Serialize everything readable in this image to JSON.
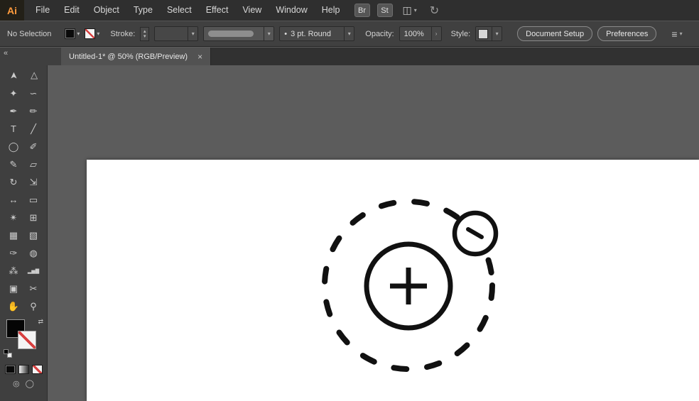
{
  "colors": {
    "accent_orange": "#ff9b3d",
    "none_red": "#d84040",
    "artboard_white": "#ffffff",
    "pasteboard_gray": "#5c5c5c",
    "bar_dark": "#2f2f2f",
    "bar_mid": "#404040",
    "art_black": "#111111"
  },
  "menubar": {
    "logo": "Ai",
    "menus": [
      "File",
      "Edit",
      "Object",
      "Type",
      "Select",
      "Effect",
      "View",
      "Window",
      "Help"
    ],
    "br_button": "Br",
    "st_button": "St",
    "workspace_icon": "◫",
    "workspace_caret": "▾",
    "sync_icon": "↻"
  },
  "controlbar": {
    "selection_status": "No Selection",
    "fill_caret": "▾",
    "stroke_swatch_caret": "▾",
    "stroke_label": "Stroke:",
    "stepper_up": "▴",
    "stepper_down": "▾",
    "stroke_width_caret": "▾",
    "width_profile_caret": "▾",
    "brush_dot": "•",
    "brush_name": "3 pt. Round",
    "brush_caret": "▾",
    "opacity_label": "Opacity:",
    "opacity_value": "100%",
    "opacity_arrow": "›",
    "style_label": "Style:",
    "style_caret": "▾",
    "document_setup_button": "Document Setup",
    "preferences_button": "Preferences",
    "align_icon": "≡",
    "align_caret": "▾"
  },
  "tabbar": {
    "collapse_icon": "«",
    "tab_title": "Untitled-1* @ 50% (RGB/Preview)",
    "close_icon": "×"
  },
  "toolbar": {
    "swap_icon": "⇄",
    "tools": [
      {
        "name": "selection-tool",
        "glyph": "➤"
      },
      {
        "name": "direct-selection-tool",
        "glyph": "▷"
      },
      {
        "name": "magic-wand-tool",
        "glyph": "✦"
      },
      {
        "name": "lasso-tool",
        "glyph": "∽"
      },
      {
        "name": "pen-tool",
        "glyph": "✒"
      },
      {
        "name": "curvature-tool",
        "glyph": "✏"
      },
      {
        "name": "type-tool",
        "glyph": "T"
      },
      {
        "name": "line-segment-tool",
        "glyph": "╱"
      },
      {
        "name": "ellipse-tool",
        "glyph": "◯"
      },
      {
        "name": "paintbrush-tool",
        "glyph": "✐"
      },
      {
        "name": "pencil-tool",
        "glyph": "✎"
      },
      {
        "name": "eraser-tool",
        "glyph": "▱"
      },
      {
        "name": "rotate-tool",
        "glyph": "↻"
      },
      {
        "name": "scale-tool",
        "glyph": "⇲"
      },
      {
        "name": "width-tool",
        "glyph": "↔"
      },
      {
        "name": "free-transform-tool",
        "glyph": "▭"
      },
      {
        "name": "shape-builder-tool",
        "glyph": "✴"
      },
      {
        "name": "perspective-grid-tool",
        "glyph": "⊞"
      },
      {
        "name": "mesh-tool",
        "glyph": "▦"
      },
      {
        "name": "gradient-tool",
        "glyph": "▧"
      },
      {
        "name": "eyedropper-tool",
        "glyph": "✑"
      },
      {
        "name": "blend-tool",
        "glyph": "◍"
      },
      {
        "name": "symbol-sprayer-tool",
        "glyph": "⁂"
      },
      {
        "name": "column-graph-tool",
        "glyph": "▂▅▇"
      },
      {
        "name": "artboard-tool",
        "glyph": "▣"
      },
      {
        "name": "slice-tool",
        "glyph": "✂"
      },
      {
        "name": "hand-tool",
        "glyph": "✋"
      },
      {
        "name": "zoom-tool",
        "glyph": "⚲"
      }
    ],
    "draw_modes": [
      {
        "name": "draw-normal-mode-icon",
        "glyph": "◎"
      },
      {
        "name": "draw-behind-mode-icon",
        "glyph": "◯"
      }
    ]
  }
}
